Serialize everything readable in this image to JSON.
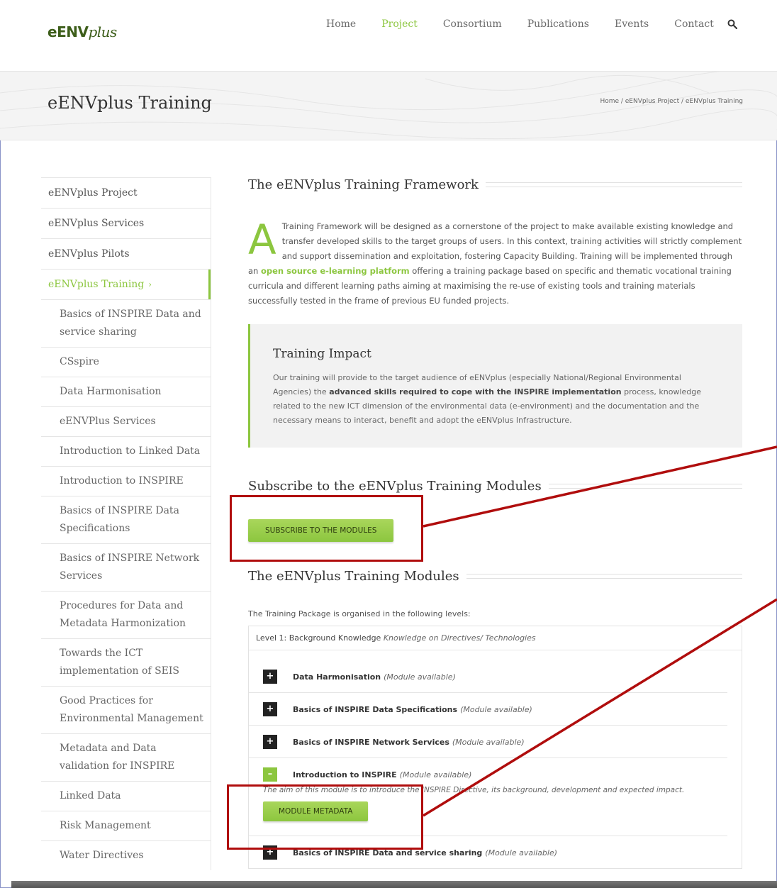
{
  "logo": {
    "text": "eENV",
    "plus": "plus"
  },
  "nav": {
    "items": [
      "Home",
      "Project",
      "Consortium",
      "Publications",
      "Events",
      "Contact"
    ],
    "active": "Project"
  },
  "title_band": {
    "title": "eENVplus Training",
    "breadcrumb": "Home / eENVplus Project / eENVplus Training"
  },
  "sidebar": {
    "main_items": [
      "eENVplus Project",
      "eENVplus Services",
      "eENVplus Pilots"
    ],
    "active_item": "eENVplus Training",
    "active_chevron": "›",
    "sub_items": [
      "Basics of INSPIRE Data and service sharing",
      "CSspire",
      "Data Harmonisation",
      "eENVPlus Services",
      "Introduction to Linked Data",
      "Introduction to INSPIRE",
      "Basics of INSPIRE Data Specifications",
      "Basics of INSPIRE Network Services",
      "Procedures for Data and Metadata Harmonization",
      "Towards the ICT implementation of SEIS",
      "Good Practices for Environmental Management",
      "Metadata and Data validation for INSPIRE",
      "Linked Data",
      "Risk Management",
      "Water Directives"
    ]
  },
  "framework": {
    "heading": "The eENVplus Training Framework",
    "dropcap": "A",
    "text_before_link": "Training Framework will be designed as a cornerstone of the project to make available existing knowledge and transfer developed skills to the target groups of users. In this context, training activities will strictly complement and support dissemination and exploitation, fostering Capacity Building. Training will be implemented through an ",
    "link": "open source e-learning platform",
    "text_after_link": " offering a training package based on specific and thematic vocational training curricula and different learning paths aiming at maximising the re-use of existing tools and training materials successfully tested in the frame of previous EU funded projects."
  },
  "impact": {
    "heading": "Training Impact",
    "text_before_bold": "Our training will provide to the target audience of eENVplus (especially National/Regional Environmental Agencies) the ",
    "bold": "advanced skills required to cope with the INSPIRE implementation",
    "text_after_bold": " process, knowledge related to the new ICT dimension of the environmental data (e-environment) and the documentation and the necessary means to interact, benefit and adopt the eENVplus Infrastructure."
  },
  "subscribe": {
    "heading": "Subscribe to the eENVplus Training Modules",
    "button": "SUBSCRIBE TO THE MODULES"
  },
  "modules": {
    "heading": "The eENVplus Training Modules",
    "intro": "The Training Package is organised in the following levels:",
    "level_title": "Level 1: Background Knowledge",
    "level_subtitle": "Knowledge on Directives/ Technologies",
    "items": [
      {
        "name": "Data Harmonisation",
        "status": "(Module available)",
        "toggle": "+"
      },
      {
        "name": "Basics of INSPIRE Data Specifications",
        "status": "(Module available)",
        "toggle": "+"
      },
      {
        "name": "Basics of INSPIRE Network Services",
        "status": "(Module available)",
        "toggle": "+"
      },
      {
        "name": "Introduction to INSPIRE",
        "status": "(Module available)",
        "toggle": "–"
      },
      {
        "name": "Basics of INSPIRE Data and service sharing",
        "status": "(Module available)",
        "toggle": "+"
      }
    ],
    "expanded_desc": "The aim of this module is to introduce the INSPIRE Directive, its background, development and expected impact.",
    "metadata_button": "MODULE METADATA"
  },
  "colors": {
    "accent": "#8cc63f",
    "annotation": "#b00d0d"
  }
}
